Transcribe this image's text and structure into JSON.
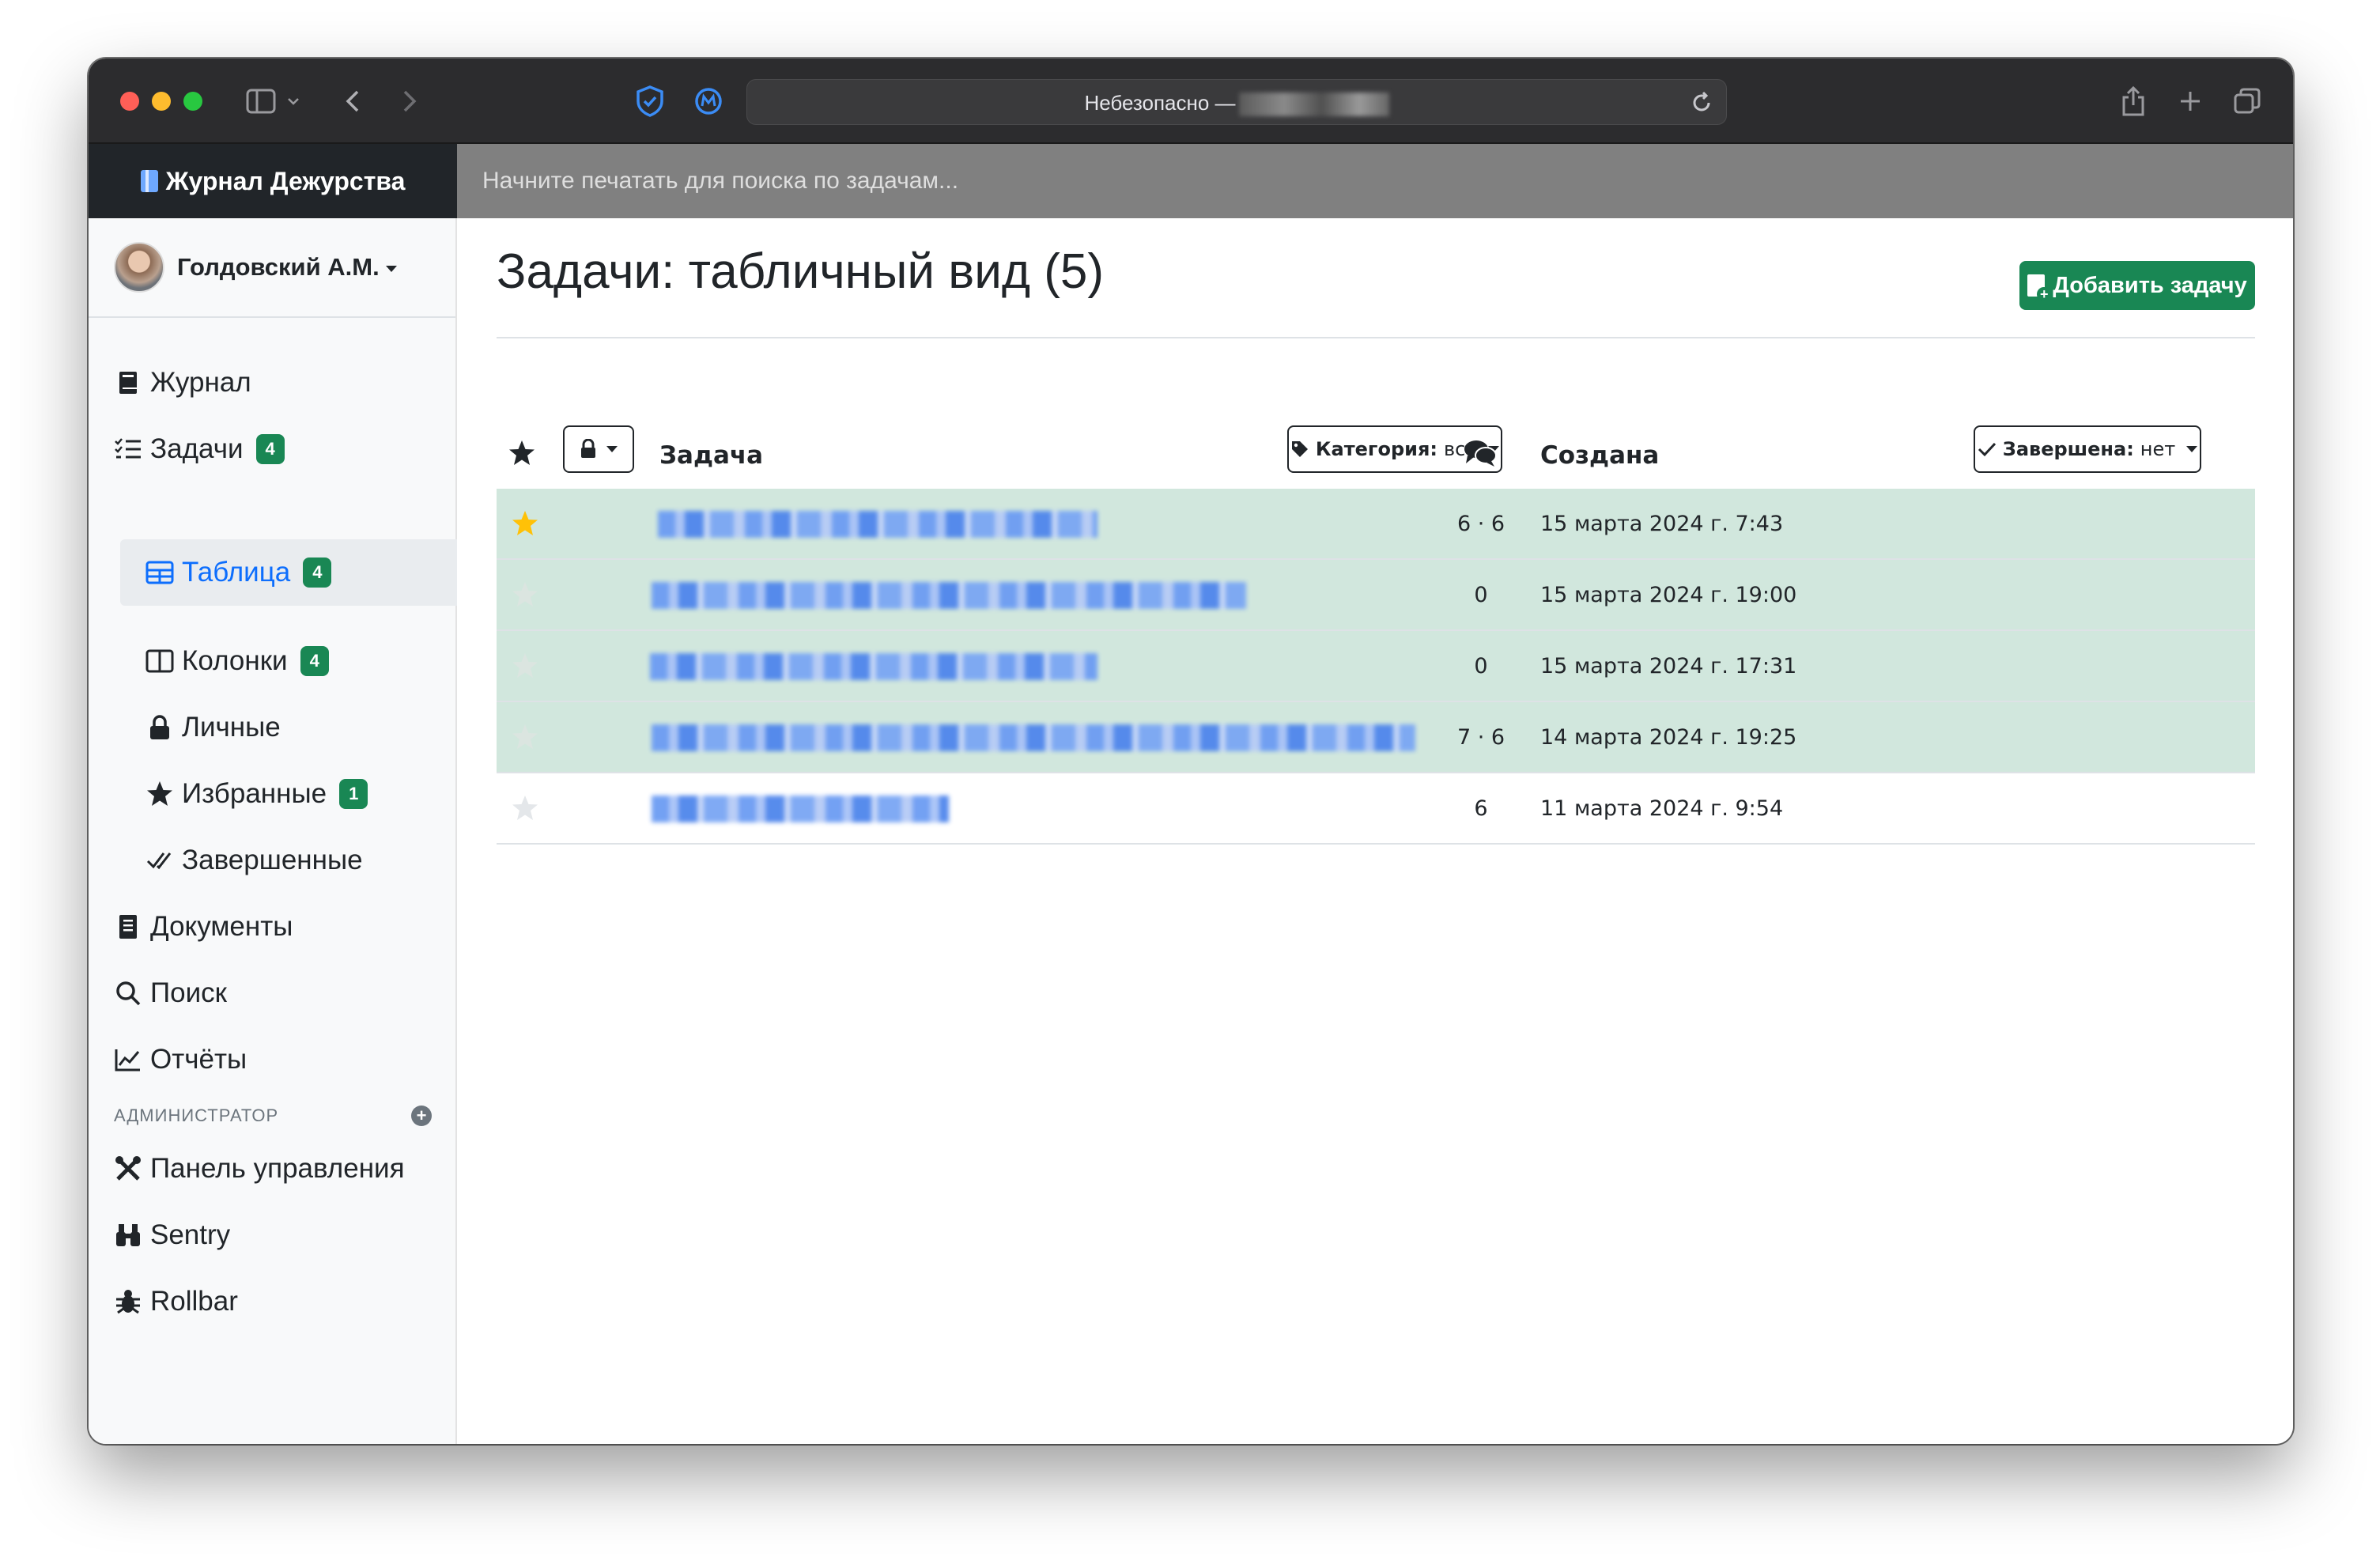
{
  "browser": {
    "url_label": "Небезопасно —"
  },
  "app": {
    "brand": "Журнал Дежурства",
    "search_placeholder": "Начните печатать для поиска по задачам..."
  },
  "sidebar": {
    "user_name": "Голдовский А.М.",
    "items": [
      {
        "label": "Журнал",
        "icon": "journal-icon"
      },
      {
        "label": "Задачи",
        "icon": "tasks-list-icon",
        "badge": "4"
      },
      {
        "label": "Таблица",
        "icon": "table-icon",
        "badge": "4",
        "active": true
      },
      {
        "label": "Колонки",
        "icon": "columns-icon",
        "badge": "4"
      },
      {
        "label": "Личные",
        "icon": "lock-icon"
      },
      {
        "label": "Избранные",
        "icon": "star-icon",
        "badge": "1"
      },
      {
        "label": "Завершенные",
        "icon": "check-all-icon"
      },
      {
        "label": "Документы",
        "icon": "documents-icon"
      },
      {
        "label": "Поиск",
        "icon": "search-icon"
      },
      {
        "label": "Отчёты",
        "icon": "chart-icon"
      }
    ],
    "admin_heading": "АДМИНИСТРАТОР",
    "admin_items": [
      {
        "label": "Панель управления",
        "icon": "tools-icon"
      },
      {
        "label": "Sentry",
        "icon": "binoculars-icon"
      },
      {
        "label": "Rollbar",
        "icon": "bug-icon"
      }
    ]
  },
  "main": {
    "title": "Задачи: табличный вид (5)",
    "add_button": "Добавить задачу",
    "columns": {
      "task": "Задача",
      "category_label": "Категория:",
      "category_value": "все",
      "created": "Создана",
      "completed_label": "Завершена:",
      "completed_value": "нет"
    },
    "rows": [
      {
        "favorite": true,
        "comments": "6 · 6",
        "created": "15 марта 2024 г. 7:43",
        "highlight": "green"
      },
      {
        "favorite": false,
        "comments": "0",
        "created": "15 марта 2024 г. 19:00",
        "highlight": "green"
      },
      {
        "favorite": false,
        "comments": "0",
        "created": "15 марта 2024 г. 17:31",
        "highlight": "green"
      },
      {
        "favorite": false,
        "comments": "7 · 6",
        "created": "14 марта 2024 г. 19:25",
        "highlight": "green"
      },
      {
        "favorite": false,
        "comments": "6",
        "created": "11 марта 2024 г. 9:54",
        "highlight": "none"
      }
    ]
  },
  "colors": {
    "accent": "#0d6efd",
    "success": "#198754",
    "row_highlight": "#d1e7dd",
    "star_active": "#ffc107",
    "star_inactive": "#dee2e6"
  }
}
